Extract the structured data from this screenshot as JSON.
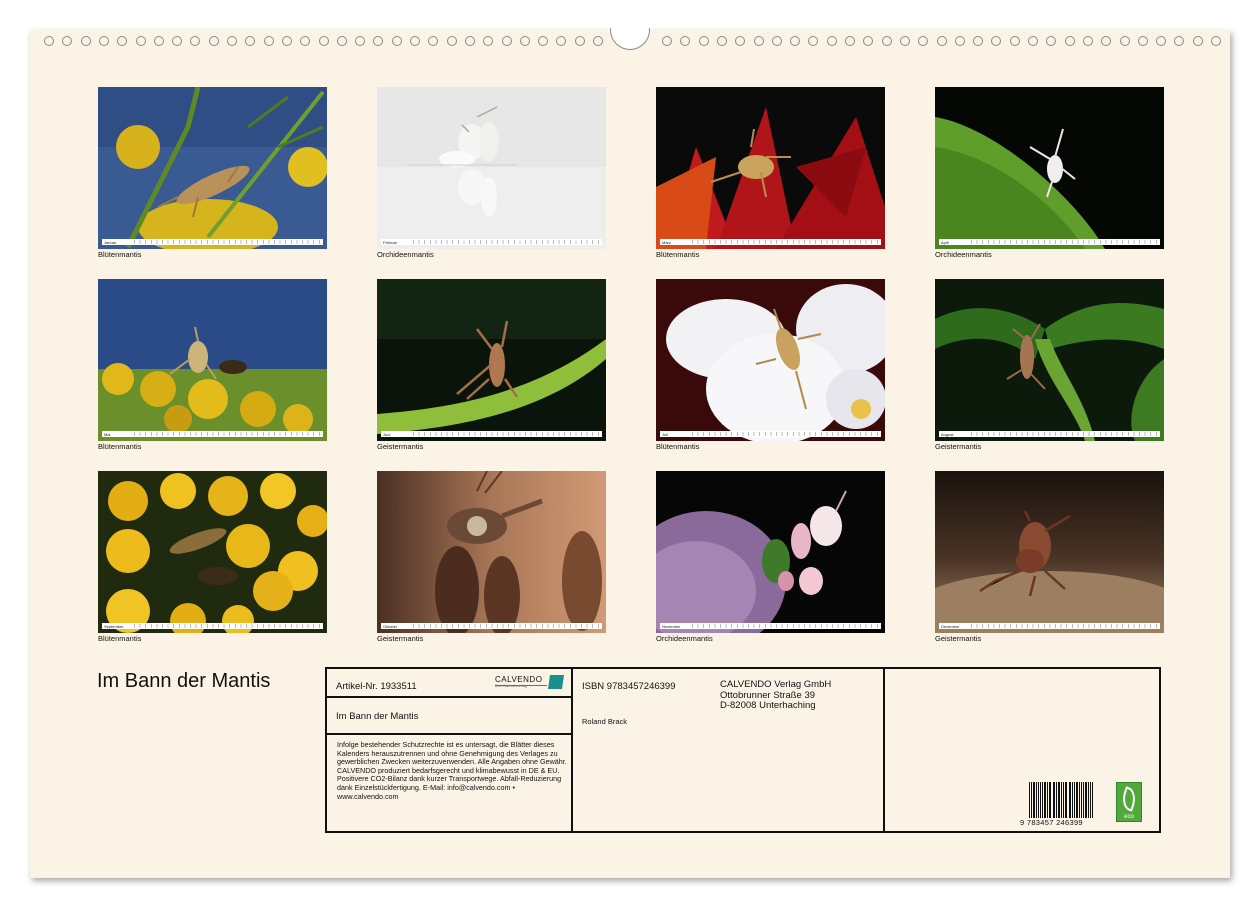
{
  "calendar_title": "Im Bann der Mantis",
  "months": [
    {
      "name": "Januar",
      "caption": "Blütenmantis"
    },
    {
      "name": "Februar",
      "caption": "Orchideenmantis"
    },
    {
      "name": "März",
      "caption": "Blütenmantis"
    },
    {
      "name": "April",
      "caption": "Orchideenmantis"
    },
    {
      "name": "Mai",
      "caption": "Blütenmantis"
    },
    {
      "name": "Juni",
      "caption": "Geistermantis"
    },
    {
      "name": "Juli",
      "caption": "Blütenmantis"
    },
    {
      "name": "August",
      "caption": "Geistermantis"
    },
    {
      "name": "September",
      "caption": "Blütenmantis"
    },
    {
      "name": "Oktober",
      "caption": "Geistermantis"
    },
    {
      "name": "November",
      "caption": "Orchideenmantis"
    },
    {
      "name": "Dezember",
      "caption": "Geistermantis"
    }
  ],
  "info": {
    "article": "Artikel-Nr. 1933511",
    "logo": "CALVENDO",
    "logo_sub": "Dein Kalenderverlag",
    "title": "Im Bann der Mantis",
    "legal": "Infolge bestehender Schutzrechte ist es untersagt, die Blätter dieses Kalenders herauszutrennen und ohne Genehmigung des Verlages zu gewerblichen Zwecken weiterzuverwenden. Alle Angaben ohne Gewähr. CALVENDO produziert bedarfsgerecht und klimabewusst in DE & EU. Positivere CO2-Bilanz dank kurzer Transportwege. Abfall-Reduzierung dank Einzelstückfertigung. E-Mail: info@calvendo.com • www.calvendo.com",
    "isbn": "ISBN 9783457246399",
    "author": "Roland Brack",
    "publisher_name": "CALVENDO Verlag GmbH",
    "publisher_street": "Ottobrunner Straße 39",
    "publisher_city": "D-82008 Unterhaching",
    "barcode_number": "9 783457 246399",
    "eco_label": "eco"
  }
}
